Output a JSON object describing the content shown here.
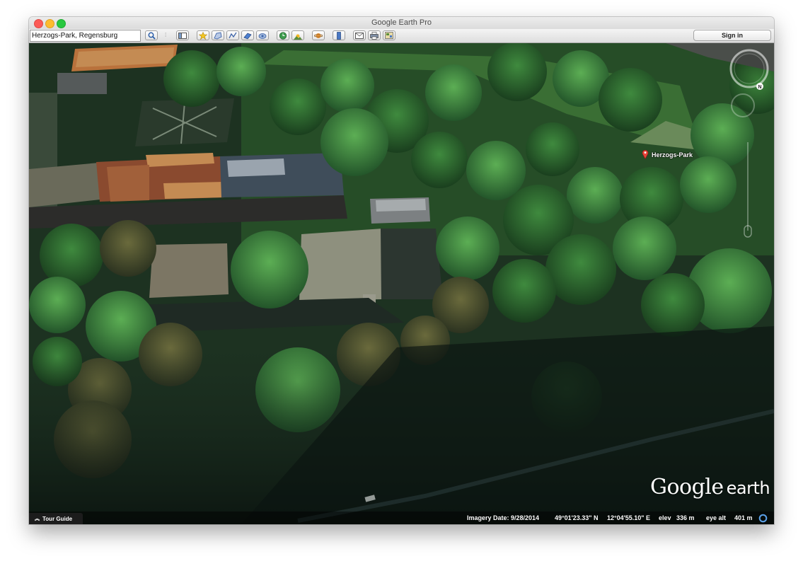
{
  "window": {
    "title": "Google Earth Pro"
  },
  "toolbar": {
    "search_value": "Herzogs-Park, Regensburg",
    "sign_in_label": "Sign in",
    "buttons": [
      "search-button",
      "sidebar-toggle-button",
      "add-placemark-button",
      "add-polygon-button",
      "add-path-button",
      "add-image-overlay-button",
      "record-tour-button",
      "historical-imagery-button",
      "sunlight-button",
      "switch-planet-button",
      "ruler-button",
      "email-button",
      "print-button",
      "view-in-maps-button"
    ]
  },
  "map": {
    "placemark_label": "Herzogs-Park",
    "compass_letter": "N",
    "logo_google": "Google",
    "logo_earth": "earth"
  },
  "statusbar": {
    "tour_guide_label": "Tour Guide",
    "imagery_date": "Imagery Date: 9/28/2014",
    "latitude": "49°01'23.33\" N",
    "longitude": "12°04'55.10\" E",
    "elev_label": "elev",
    "elev_value": "336 m",
    "eye_alt_label": "eye alt",
    "eye_alt_value": "401 m"
  },
  "colors": {
    "close": "#fc5b57",
    "minimize": "#fdbc2e",
    "maximize": "#28c840",
    "placemark": "#e8443a"
  }
}
